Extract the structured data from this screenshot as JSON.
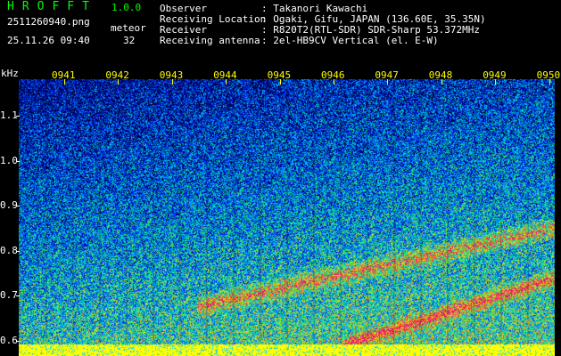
{
  "header": {
    "app_title": "HROFFT",
    "app_version": "1.0.0",
    "file_name": "2511260940.png",
    "mode_label": "meteor",
    "date_time": "25.11.26 09:40",
    "count_value": "32"
  },
  "info": [
    {
      "key": "Observer",
      "value": ": Takanori Kawachi"
    },
    {
      "key": "Receiving Location",
      "value": ": Ogaki, Gifu, JAPAN (136.60E, 35.35N)"
    },
    {
      "key": "Receiver",
      "value": ": R820T2(RTL-SDR) SDR-Sharp 53.372MHz"
    },
    {
      "key": "Receiving antenna",
      "value": ": 2el-HB9CV Vertical (el. E-W)"
    }
  ],
  "axes": {
    "y_unit": "kHz",
    "y_ticks": [
      "1.1",
      "1.0",
      "0.9",
      "0.8",
      "0.7",
      "0.6"
    ],
    "x_ticks": [
      "0941",
      "0942",
      "0943",
      "0944",
      "0945",
      "0946",
      "0947",
      "0948",
      "0949",
      "0950"
    ]
  },
  "colors": {
    "background": "#000000",
    "label_white": "#ffffff",
    "label_yellow": "#ffff00",
    "label_green": "#00ff00"
  }
}
